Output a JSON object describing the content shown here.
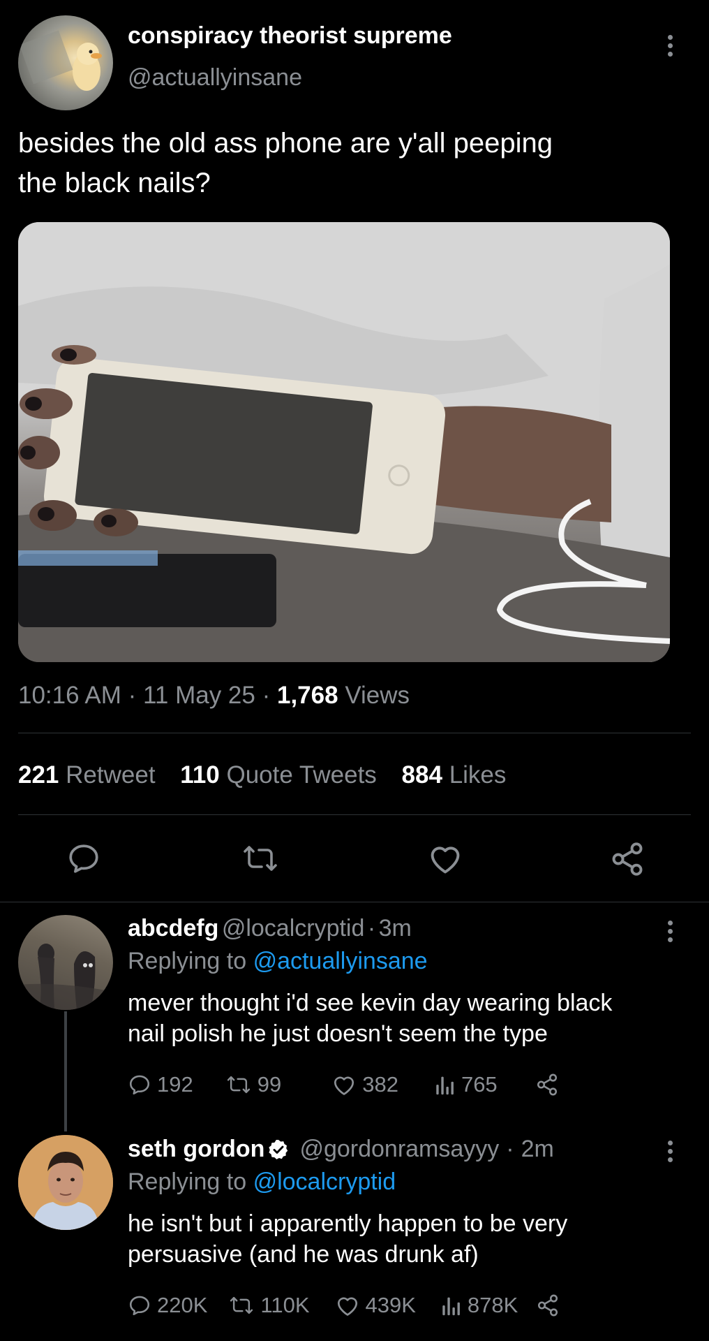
{
  "tweet": {
    "display_name": "conspiracy theorist supreme",
    "handle": "@actuallyinsane",
    "text_line1": "besides the old ass phone are y'all peeping",
    "text_line2": "the black nails?",
    "time": "10:16 AM",
    "date": "11 May 25",
    "views_count": "1,768",
    "views_label": "Views",
    "retweet_count": "221",
    "retweet_label": "Retweet",
    "quote_count": "110",
    "quote_label": "Quote Tweets",
    "likes_count": "884",
    "likes_label": "Likes",
    "separator": "·"
  },
  "replies": [
    {
      "display_name": "abcdefg",
      "handle": "@localcryptid",
      "time": "3m",
      "replying_label": "Replying to",
      "replying_to": "@actuallyinsane",
      "text_line1": "mever thought i'd see kevin day wearing black",
      "text_line2": "nail polish he just doesn't seem the type",
      "replies": "192",
      "retweets": "99",
      "likes": "382",
      "views": "765"
    },
    {
      "display_name": "seth gordon",
      "handle": "@gordonramsayyy",
      "time": "2m",
      "verified": true,
      "replying_label": "Replying to",
      "replying_to": "@localcryptid",
      "text_line1": "he isn't but i apparently happen to be very",
      "text_line2": "persuasive (and he was drunk af)",
      "replies": "220K",
      "retweets": "110K",
      "likes": "439K",
      "views": "878K"
    }
  ],
  "icons": {
    "reply": "reply-icon",
    "retweet": "retweet-icon",
    "like": "heart-icon",
    "share": "share-icon",
    "views": "views-icon",
    "more": "more-icon",
    "verified": "verified-badge-icon"
  },
  "colors": {
    "background": "#000000",
    "text": "#ffffff",
    "secondary": "#8b8f94",
    "link": "#1d9bf0",
    "divider": "#2f3336"
  }
}
